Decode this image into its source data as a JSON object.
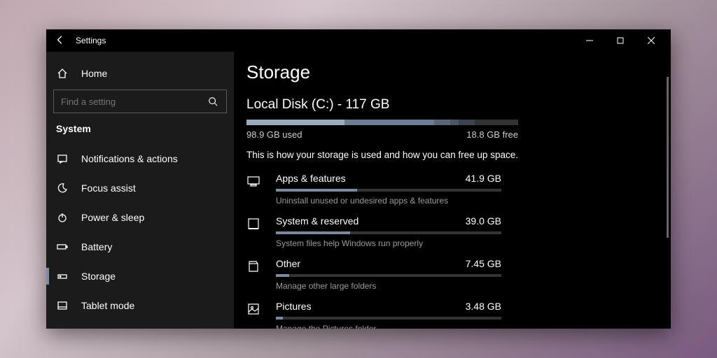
{
  "titlebar": {
    "title": "Settings"
  },
  "sidebar": {
    "home": "Home",
    "search_placeholder": "Find a setting",
    "category": "System",
    "items": [
      {
        "label": "Notifications & actions"
      },
      {
        "label": "Focus assist"
      },
      {
        "label": "Power & sleep"
      },
      {
        "label": "Battery"
      },
      {
        "label": "Storage"
      },
      {
        "label": "Tablet mode"
      }
    ]
  },
  "page": {
    "title": "Storage",
    "disk_title": "Local Disk (C:) - 117 GB",
    "used_label": "98.9 GB used",
    "free_label": "18.8 GB free",
    "description": "This is how your storage is used and how you can free up space."
  },
  "categories": [
    {
      "name": "Apps & features",
      "size": "41.9 GB",
      "sub": "Uninstall unused or undesired apps & features",
      "pct": 36
    },
    {
      "name": "System & reserved",
      "size": "39.0 GB",
      "sub": "System files help Windows run properly",
      "pct": 33
    },
    {
      "name": "Other",
      "size": "7.45 GB",
      "sub": "Manage other large folders",
      "pct": 6
    },
    {
      "name": "Pictures",
      "size": "3.48 GB",
      "sub": "Manage the Pictures folder",
      "pct": 3
    }
  ],
  "disk_segments": [
    {
      "start": 0,
      "width": 36,
      "color": "#9aaabf"
    },
    {
      "start": 36,
      "width": 33,
      "color": "#6c7d93"
    },
    {
      "start": 69,
      "width": 6,
      "color": "#5a6576"
    },
    {
      "start": 75,
      "width": 3,
      "color": "#4b5463"
    },
    {
      "start": 78,
      "width": 6,
      "color": "#3c434f"
    }
  ]
}
